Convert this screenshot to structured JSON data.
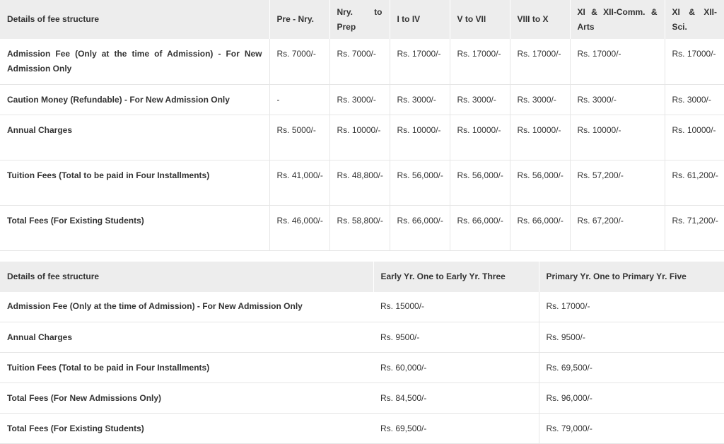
{
  "table1": {
    "header": [
      "Details of fee structure",
      "Pre - Nry.",
      "Nry. to Prep",
      "I to IV",
      "V to VII",
      "VIII to X",
      "XI & XII-Comm. & Arts",
      "XI & XII-Sci."
    ],
    "rows": [
      {
        "label": "Admission Fee (Only at the time of Admission) - For New Admission Only",
        "values": [
          "Rs. 7000/-",
          "Rs. 7000/-",
          "Rs. 17000/-",
          "Rs. 17000/-",
          "Rs. 17000/-",
          "Rs. 17000/-",
          "Rs. 17000/-"
        ]
      },
      {
        "label": "Caution Money (Refundable) - For New Admission Only",
        "values": [
          "-",
          "Rs. 3000/-",
          "Rs. 3000/-",
          "Rs. 3000/-",
          "Rs. 3000/-",
          "Rs. 3000/-",
          "Rs. 3000/-"
        ]
      },
      {
        "label": "Annual Charges",
        "values": [
          "Rs. 5000/-",
          "Rs. 10000/-",
          "Rs. 10000/-",
          "Rs. 10000/-",
          "Rs. 10000/-",
          "Rs. 10000/-",
          "Rs. 10000/-"
        ]
      },
      {
        "label": "Tuition Fees (Total to be paid in Four Installments)",
        "values": [
          "Rs. 41,000/-",
          "Rs. 48,800/-",
          "Rs. 56,000/-",
          "Rs. 56,000/-",
          "Rs. 56,000/-",
          "Rs. 57,200/-",
          "Rs. 61,200/-"
        ]
      },
      {
        "label": "Total Fees (For Existing Students)",
        "values": [
          "Rs. 46,000/-",
          "Rs. 58,800/-",
          "Rs. 66,000/-",
          "Rs. 66,000/-",
          "Rs. 66,000/-",
          "Rs. 67,200/-",
          "Rs. 71,200/-"
        ]
      }
    ]
  },
  "table2": {
    "header": [
      "Details of fee structure",
      "Early Yr. One to Early Yr. Three",
      "Primary Yr. One to Primary Yr. Five"
    ],
    "rows": [
      {
        "label": "Admission Fee (Only at the time of Admission) - For New Admission Only",
        "values": [
          "Rs. 15000/-",
          "Rs. 17000/-"
        ]
      },
      {
        "label": "Annual Charges",
        "values": [
          "Rs. 9500/-",
          "Rs. 9500/-"
        ]
      },
      {
        "label": "Tuition Fees (Total to be paid in Four Installments)",
        "values": [
          "Rs. 60,000/-",
          "Rs. 69,500/-"
        ]
      },
      {
        "label": "Total Fees (For New Admissions Only)",
        "values": [
          "Rs. 84,500/-",
          "Rs. 96,000/-"
        ]
      },
      {
        "label": "Total Fees (For Existing Students)",
        "values": [
          "Rs. 69,500/-",
          "Rs. 79,000/-"
        ]
      }
    ]
  }
}
